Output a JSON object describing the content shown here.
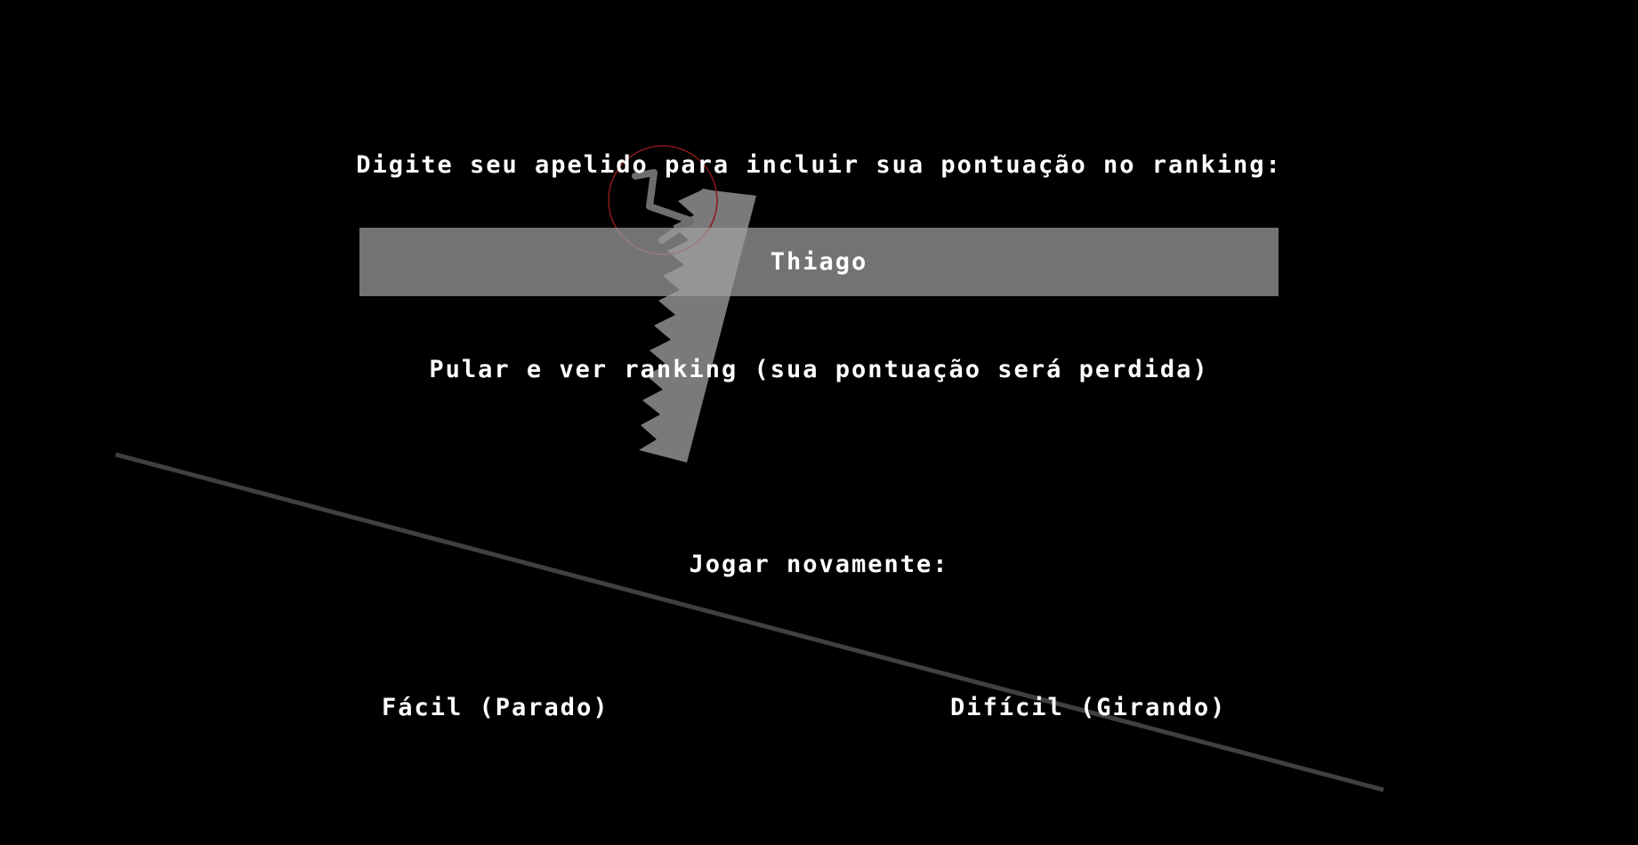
{
  "nickname": {
    "prompt": "Digite seu apelido para incluir sua pontuação no ranking:",
    "value": "Thiago"
  },
  "skip": {
    "label": "Pular e ver ranking (sua pontuação será perdida)"
  },
  "play_again": {
    "label": "Jogar novamente:",
    "easy_label": "Fácil (Parado)",
    "hard_label": "Difícil (Girando)"
  },
  "colors": {
    "background": "#000000",
    "text": "#ffffff",
    "input_bg": "#808080",
    "line": "#404040",
    "knife": "#9a9a9a",
    "target_ring": "#8b1a1a"
  }
}
